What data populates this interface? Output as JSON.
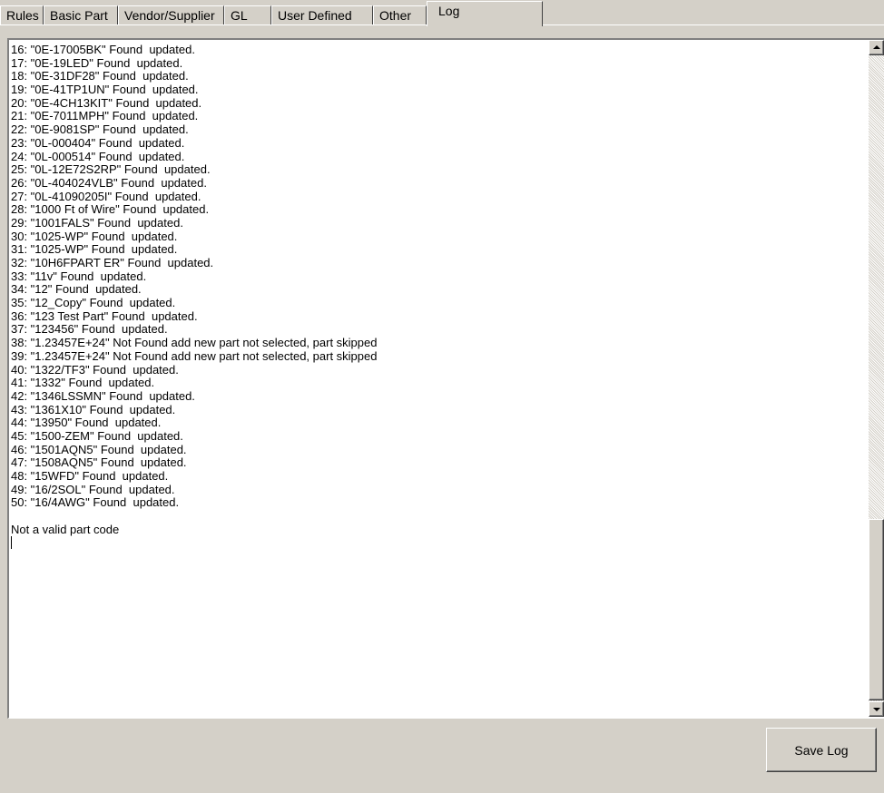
{
  "tabs": [
    {
      "label": "Rules",
      "active": false
    },
    {
      "label": "Basic Part",
      "active": false
    },
    {
      "label": "Vendor/Supplier",
      "active": false
    },
    {
      "label": "GL",
      "active": false
    },
    {
      "label": "User Defined",
      "active": false
    },
    {
      "label": "Other",
      "active": false
    },
    {
      "label": "Log",
      "active": true
    }
  ],
  "log": {
    "lines": [
      "16: \"0E-17005BK\" Found  updated.",
      "17: \"0E-19LED\" Found  updated.",
      "18: \"0E-31DF28\" Found  updated.",
      "19: \"0E-41TP1UN\" Found  updated.",
      "20: \"0E-4CH13KIT\" Found  updated.",
      "21: \"0E-7011MPH\" Found  updated.",
      "22: \"0E-9081SP\" Found  updated.",
      "23: \"0L-000404\" Found  updated.",
      "24: \"0L-000514\" Found  updated.",
      "25: \"0L-12E72S2RP\" Found  updated.",
      "26: \"0L-404024VLB\" Found  updated.",
      "27: \"0L-41090205I\" Found  updated.",
      "28: \"1000 Ft of Wire\" Found  updated.",
      "29: \"1001FALS\" Found  updated.",
      "30: \"1025-WP\" Found  updated.",
      "31: \"1025-WP\" Found  updated.",
      "32: \"10H6FPART ER\" Found  updated.",
      "33: \"11v\" Found  updated.",
      "34: \"12\" Found  updated.",
      "35: \"12_Copy\" Found  updated.",
      "36: \"123 Test Part\" Found  updated.",
      "37: \"123456\" Found  updated.",
      "38: \"1.23457E+24\" Not Found add new part not selected, part skipped",
      "39: \"1.23457E+24\" Not Found add new part not selected, part skipped",
      "40: \"1322/TF3\" Found  updated.",
      "41: \"1332\" Found  updated.",
      "42: \"1346LSSMN\" Found  updated.",
      "43: \"1361X10\" Found  updated.",
      "44: \"13950\" Found  updated.",
      "45: \"1500-ZEM\" Found  updated.",
      "46: \"1501AQN5\" Found  updated.",
      "47: \"1508AQN5\" Found  updated.",
      "48: \"15WFD\" Found  updated.",
      "49: \"16/2SOL\" Found  updated.",
      "50: \"16/4AWG\" Found  updated."
    ],
    "footer_message": "Not a valid part code"
  },
  "buttons": {
    "save_log": "Save Log"
  },
  "icons": {
    "scroll_up": "scroll-up-arrow-icon",
    "scroll_down": "scroll-down-arrow-icon"
  },
  "colors": {
    "window_bg": "#d4d0c8",
    "text_bg": "#ffffff"
  }
}
